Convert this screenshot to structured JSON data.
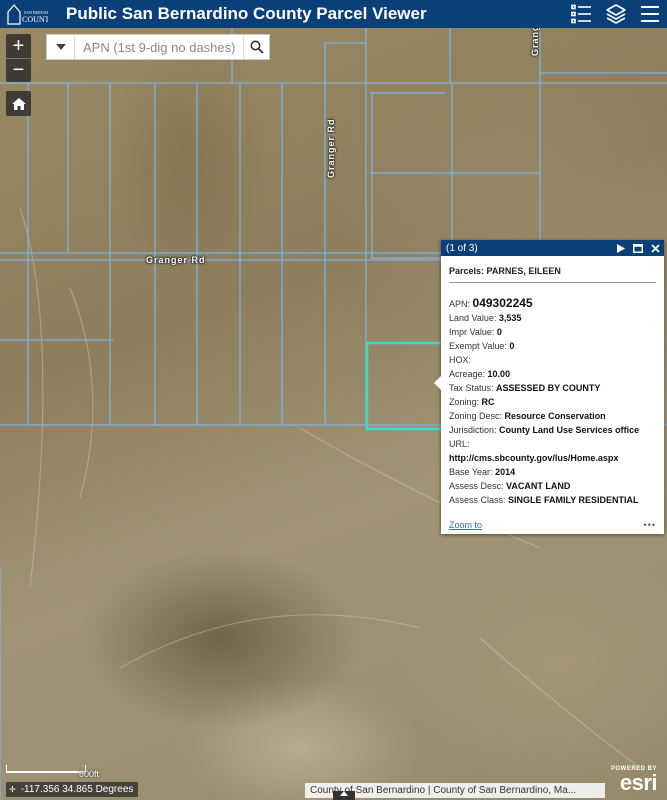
{
  "header": {
    "title": "Public San Bernardino County Parcel Viewer",
    "logo_text": "SAN BERNARDINO COUNTY",
    "icons": [
      "legend-list-icon",
      "layers-icon",
      "menu-icon"
    ]
  },
  "search": {
    "placeholder": "APN (1st 9-dig no dashes)"
  },
  "zoom": {
    "in_label": "+",
    "out_label": "−"
  },
  "roads": {
    "granger_horizontal": "Granger Rd",
    "granger_vertical": "Granger Rd",
    "granger_top": "Granger"
  },
  "popup": {
    "counter": "(1 of 3)",
    "title": "Parcels: PARNES, EILEEN",
    "fields": {
      "apn_label": "APN:",
      "apn_value": "049302245",
      "land_value_label": "Land Value:",
      "land_value": "3,535",
      "impr_value_label": "Impr Value:",
      "impr_value": "0",
      "exempt_value_label": "Exempt Value:",
      "exempt_value": "0",
      "hox_label": "HOX:",
      "acreage_label": "Acreage:",
      "acreage": "10.00",
      "tax_status_label": "Tax Status:",
      "tax_status": "ASSESSED BY COUNTY",
      "zoning_label": "Zoning:",
      "zoning": "RC",
      "zoning_desc_label": "Zoning Desc:",
      "zoning_desc": "Resource Conservation",
      "jurisdiction_label": "Jurisdiction:",
      "jurisdiction": "County Land Use Services office",
      "url_label": "URL:",
      "url": "http://cms.sbcounty.gov/lus/Home.aspx",
      "base_year_label": "Base Year:",
      "base_year": "2014",
      "assess_desc_label": "Assess Desc:",
      "assess_desc": "VACANT LAND",
      "assess_class_label": "Assess Class:",
      "assess_class": "SINGLE FAMILY RESIDENTIAL"
    },
    "zoom_to": "Zoom to",
    "more": "•••"
  },
  "footer": {
    "scale": "600ft",
    "coordinates": "-117.356 34.865 Degrees",
    "attribution": "County of San Bernardino | County of San Bernardino, Ma...",
    "esri_powered": "POWERED BY",
    "esri": "esri"
  },
  "colors": {
    "header_bg": "#0b3f78",
    "parcel_line": "#7fb4e6",
    "selected_parcel": "#33e0d0"
  }
}
